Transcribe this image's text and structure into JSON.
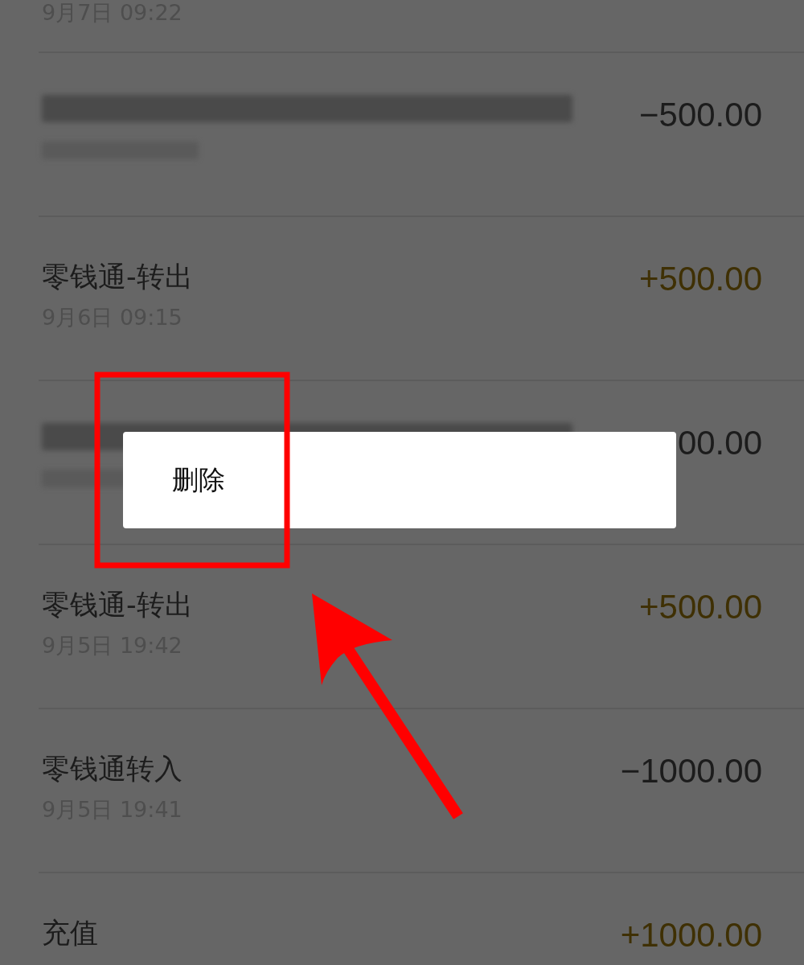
{
  "top_row": {
    "date": "9月7日 09:22"
  },
  "transactions": [
    {
      "kind": "blurred",
      "amount": "−500.00",
      "income": false
    },
    {
      "kind": "plain",
      "title": "零钱通-转出",
      "date": "9月6日 09:15",
      "amount": "+500.00",
      "income": true
    },
    {
      "kind": "blurred",
      "amount": "00.00",
      "income": false
    },
    {
      "kind": "plain",
      "title": "零钱通-转出",
      "date": "9月5日 19:42",
      "amount": "+500.00",
      "income": true
    },
    {
      "kind": "plain",
      "title": "零钱通转入",
      "date": "9月5日 19:41",
      "amount": "−1000.00",
      "income": false
    },
    {
      "kind": "plain",
      "title": "充值",
      "amount": "+1000.00",
      "income": true
    }
  ],
  "context_menu": {
    "items": [
      {
        "label": "删除"
      }
    ]
  }
}
